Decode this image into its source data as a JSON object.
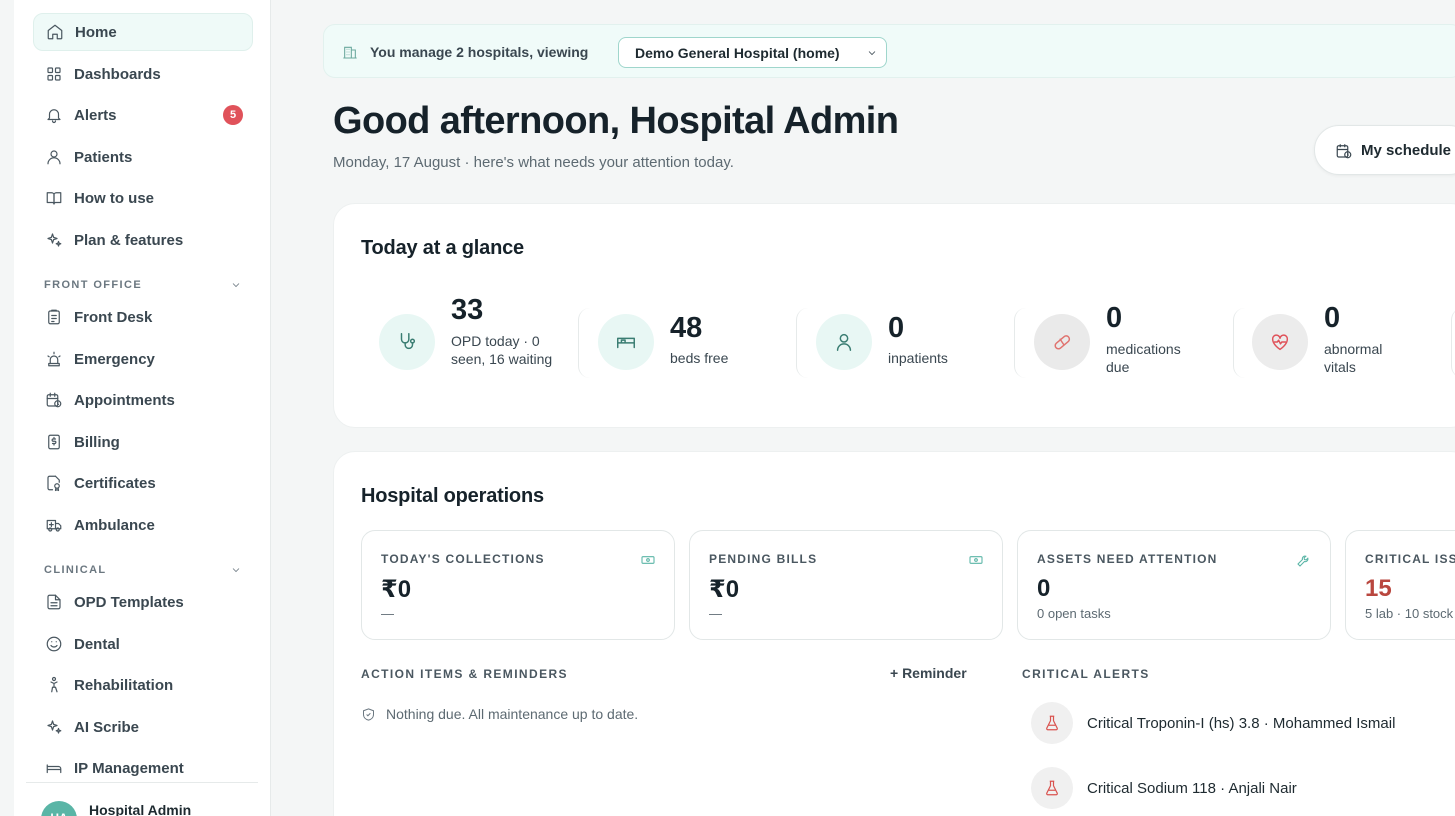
{
  "sidebar": {
    "items": [
      {
        "label": "Home"
      },
      {
        "label": "Dashboards"
      },
      {
        "label": "Alerts",
        "badge": "5"
      },
      {
        "label": "Patients"
      },
      {
        "label": "How to use"
      },
      {
        "label": "Plan & features"
      }
    ],
    "front_office": {
      "label": "FRONT OFFICE",
      "items": [
        {
          "label": "Front Desk"
        },
        {
          "label": "Emergency"
        },
        {
          "label": "Appointments"
        },
        {
          "label": "Billing"
        },
        {
          "label": "Certificates"
        },
        {
          "label": "Ambulance"
        }
      ]
    },
    "clinical": {
      "label": "CLINICAL",
      "items": [
        {
          "label": "OPD Templates"
        },
        {
          "label": "Dental"
        },
        {
          "label": "Rehabilitation"
        },
        {
          "label": "AI Scribe"
        },
        {
          "label": "IP Management"
        }
      ]
    },
    "user": {
      "initials": "HA",
      "name": "Hospital Admin"
    }
  },
  "banner": {
    "text": "You manage 2 hospitals, viewing",
    "selected_hospital": "Demo General Hospital (home)"
  },
  "header": {
    "greeting": "Good afternoon, Hospital Admin",
    "subline": "Monday, 17 August · here's what needs your attention today.",
    "schedule_button": "My schedule"
  },
  "glance": {
    "title": "Today at a glance",
    "stats": [
      {
        "value": "33",
        "label": "OPD today · 0 seen, 16 waiting",
        "icon": "stethoscope-icon"
      },
      {
        "value": "48",
        "label": "beds free",
        "icon": "bed-icon"
      },
      {
        "value": "0",
        "label": "inpatients",
        "icon": "user-icon"
      },
      {
        "value": "0",
        "label": "medications due",
        "icon": "pill-icon"
      },
      {
        "value": "0",
        "label": "abnormal vitals",
        "icon": "heart-pulse-icon"
      }
    ]
  },
  "operations": {
    "title": "Hospital operations",
    "cards": [
      {
        "header": "TODAY'S COLLECTIONS",
        "value": "₹0",
        "sub": "—",
        "icon": "cash-icon"
      },
      {
        "header": "PENDING BILLS",
        "value": "₹0",
        "sub": "—",
        "icon": "cash-icon"
      },
      {
        "header": "ASSETS NEED ATTENTION",
        "value": "0",
        "sub": "0 open tasks",
        "icon": "wrench-icon"
      },
      {
        "header": "CRITICAL ISS",
        "value": "15",
        "sub": "5 lab · 10 stock",
        "icon": "alert-icon"
      }
    ],
    "action_items": {
      "title": "ACTION ITEMS & REMINDERS",
      "reminder_button": "+ Reminder",
      "empty_text": "Nothing due. All maintenance up to date."
    },
    "critical_alerts": {
      "title": "CRITICAL ALERTS",
      "items": [
        {
          "text": "Critical Troponin-I (hs) 3.8 · Mohammed Ismail"
        },
        {
          "text": "Critical Sodium 118 · Anjali Nair"
        }
      ]
    }
  },
  "colors": {
    "accent": "#5ab5a6",
    "badge": "#e0525a",
    "critical": "#b9473f"
  }
}
